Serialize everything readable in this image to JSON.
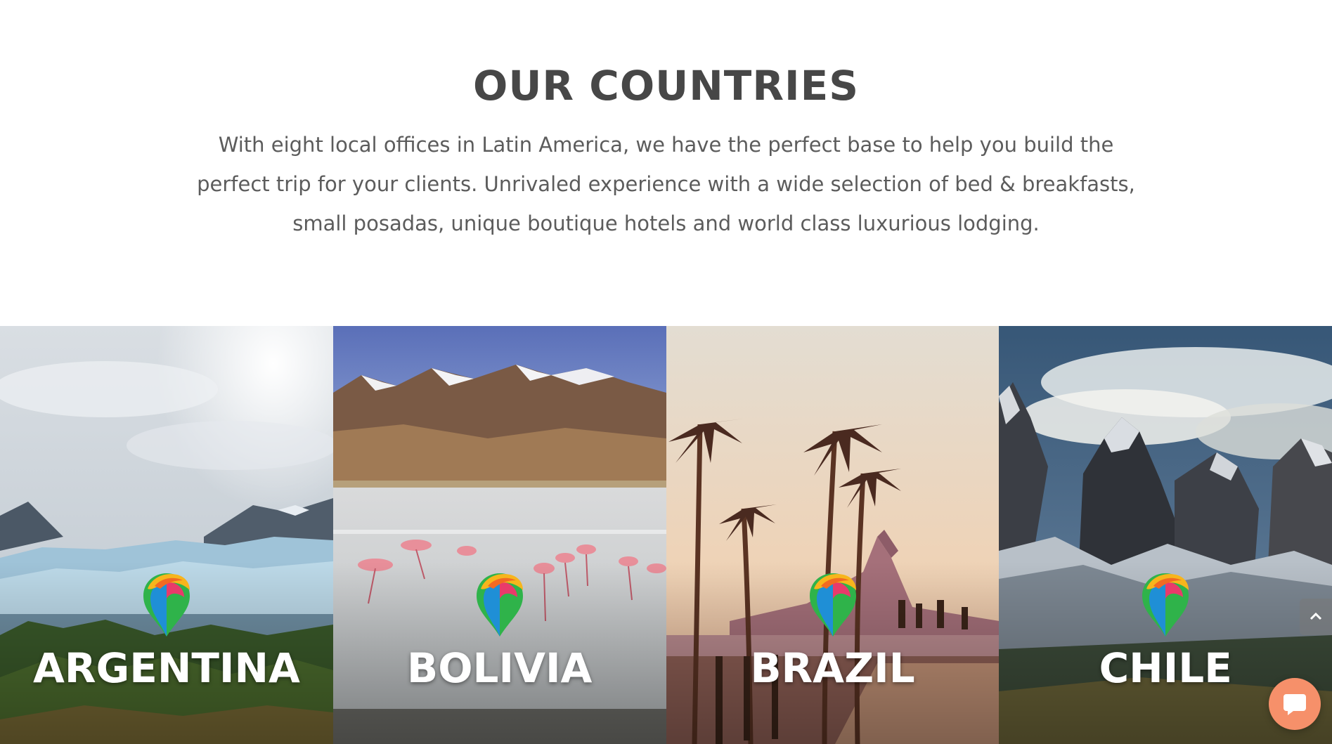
{
  "section": {
    "title": "OUR COUNTRIES",
    "description": "With eight local offices in Latin America, we have the perfect base to help you build the perfect trip for your clients. Unrivaled experience with a wide selection of bed & breakfasts, small posadas, unique boutique hotels and world class luxurious lodging."
  },
  "countries": [
    {
      "label": "ARGENTINA",
      "scene": "glacier-and-forest"
    },
    {
      "label": "BOLIVIA",
      "scene": "flamingos-lagoon-mountains"
    },
    {
      "label": "BRAZIL",
      "scene": "palm-trees-beach-promenade"
    },
    {
      "label": "CHILE",
      "scene": "snowy-granite-peaks"
    }
  ],
  "icons": {
    "pin": "map-pin-logo-icon",
    "scroll_top": "chevron-up-icon",
    "chat": "chat-bubble-icon"
  },
  "colors": {
    "heading": "#474747",
    "body_text": "#5c5c5c",
    "chat_button": "#f6906a"
  }
}
